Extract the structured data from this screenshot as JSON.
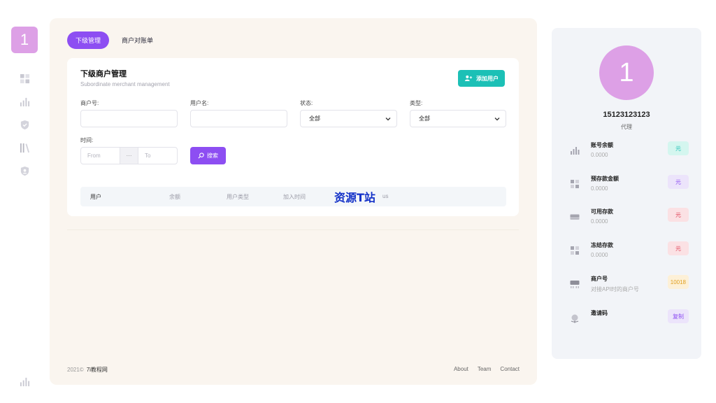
{
  "sidebar": {
    "avatar_text": "1"
  },
  "tabs": [
    {
      "label": "下级管理",
      "active": true
    },
    {
      "label": "商户对账单",
      "active": false
    }
  ],
  "card": {
    "title": "下级商户管理",
    "subtitle": "Subordinate merchant management",
    "add_button": "添加用户"
  },
  "filters": {
    "merchant_no_label": "商户号:",
    "merchant_no_value": "",
    "username_label": "用户名:",
    "username_value": "",
    "status_label": "状态:",
    "status_value": "全部",
    "type_label": "类型:",
    "type_value": "全部",
    "time_label": "时间:",
    "from_placeholder": "From",
    "range_sep": "···",
    "to_placeholder": "To",
    "search_button": "搜索"
  },
  "table": {
    "columns": [
      "用户",
      "余额",
      "用户类型",
      "加入时间",
      "us"
    ]
  },
  "watermark": "资源T站",
  "footer": {
    "copyright": "2021©",
    "site": "7i教程网",
    "links": [
      "About",
      "Team",
      "Contact"
    ]
  },
  "profile": {
    "avatar_text": "1",
    "name": "15123123123",
    "role": "代理",
    "stats": [
      {
        "title": "账号余额",
        "value": "0.0000",
        "badge": "元",
        "icon": "bar-chart-icon",
        "badge_bg": "#d4f6ef",
        "badge_fg": "#1cc0b6"
      },
      {
        "title": "预存款金额",
        "value": "0.0000",
        "badge": "元",
        "icon": "grid-icon",
        "badge_bg": "#ece4fb",
        "badge_fg": "#8d4ef2"
      },
      {
        "title": "可用存款",
        "value": "0.0000",
        "badge": "元",
        "icon": "card-icon",
        "badge_bg": "#fbe1e4",
        "badge_fg": "#e0445a"
      },
      {
        "title": "冻结存款",
        "value": "0.0000",
        "badge": "元",
        "icon": "grid-icon",
        "badge_bg": "#fbe1e4",
        "badge_fg": "#e0445a"
      },
      {
        "title": "商户号",
        "value": "对接API时的商户号",
        "badge": "10018",
        "icon": "terminal-icon",
        "badge_bg": "#fdf0d7",
        "badge_fg": "#e0a021"
      },
      {
        "title": "邀请码",
        "value": "",
        "badge": "复制",
        "icon": "globe-icon",
        "badge_bg": "#ece4fb",
        "badge_fg": "#8d4ef2"
      }
    ]
  }
}
